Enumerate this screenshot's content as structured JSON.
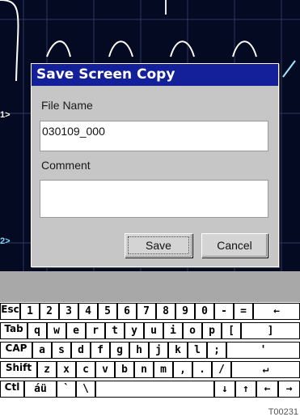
{
  "scope": {
    "channel_markers": [
      "1>",
      "2>"
    ]
  },
  "dialog": {
    "title": "Save Screen Copy",
    "file_name_label": "File Name",
    "file_name_value": "030109_000",
    "comment_label": "Comment",
    "comment_value": "",
    "save_label": "Save",
    "cancel_label": "Cancel"
  },
  "keyboard": {
    "rows": [
      [
        "Esc",
        "1",
        "2",
        "3",
        "4",
        "5",
        "6",
        "7",
        "8",
        "9",
        "0",
        "-",
        "=",
        "←"
      ],
      [
        "Tab",
        "q",
        "w",
        "e",
        "r",
        "t",
        "y",
        "u",
        "i",
        "o",
        "p",
        "[",
        "]"
      ],
      [
        "CAP",
        "a",
        "s",
        "d",
        "f",
        "g",
        "h",
        "j",
        "k",
        "l",
        ";",
        "'"
      ],
      [
        "Shift",
        "z",
        "x",
        "c",
        "v",
        "b",
        "n",
        "m",
        ",",
        ".",
        "/",
        "↵"
      ],
      [
        "Ctl",
        "áü",
        "`",
        "\\",
        " ",
        "↓",
        "↑",
        "←",
        "→"
      ]
    ]
  },
  "watermark": "T00231"
}
